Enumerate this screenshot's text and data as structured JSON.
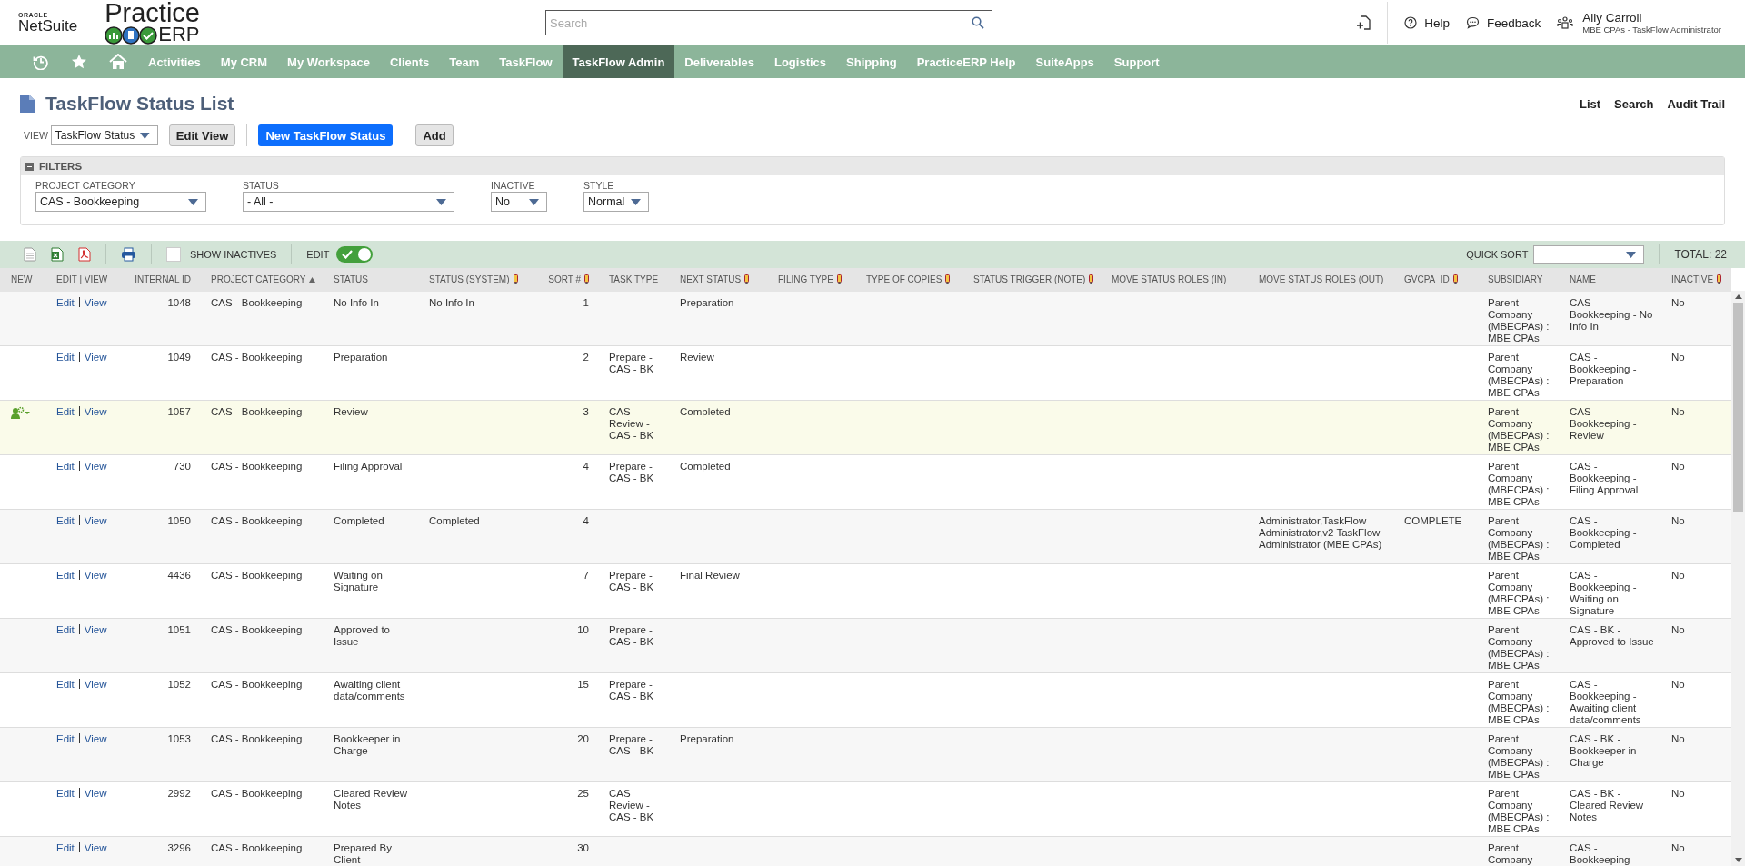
{
  "logo": {
    "oracle": "ORACLE",
    "netsuite": "NetSuite",
    "practice": "Practice",
    "erp": "ERP"
  },
  "search": {
    "placeholder": "Search"
  },
  "header_links": [
    {
      "kind": "help",
      "label": "Help"
    },
    {
      "kind": "feedback",
      "label": "Feedback"
    }
  ],
  "user": {
    "name": "Ally Carroll",
    "role": "MBE CPAs - TaskFlow Administrator"
  },
  "nav": [
    {
      "kind": "recent",
      "selected": false
    },
    {
      "kind": "star",
      "selected": false
    },
    {
      "kind": "home",
      "selected": false
    },
    {
      "kind": "text",
      "label": "Activities",
      "selected": false
    },
    {
      "kind": "text",
      "label": "My CRM",
      "selected": false
    },
    {
      "kind": "text",
      "label": "My Workspace",
      "selected": false
    },
    {
      "kind": "text",
      "label": "Clients",
      "selected": false
    },
    {
      "kind": "text",
      "label": "Team",
      "selected": false
    },
    {
      "kind": "text",
      "label": "TaskFlow",
      "selected": false
    },
    {
      "kind": "text",
      "label": "TaskFlow Admin",
      "selected": true
    },
    {
      "kind": "text",
      "label": "Deliverables",
      "selected": false
    },
    {
      "kind": "text",
      "label": "Logistics",
      "selected": false
    },
    {
      "kind": "text",
      "label": "Shipping",
      "selected": false
    },
    {
      "kind": "text",
      "label": "PracticeERP Help",
      "selected": false
    },
    {
      "kind": "text",
      "label": "SuiteApps",
      "selected": false
    },
    {
      "kind": "text",
      "label": "Support",
      "selected": false
    }
  ],
  "page_title": "TaskFlow Status List",
  "page_links": [
    "List",
    "Search",
    "Audit Trail"
  ],
  "view": {
    "label": "VIEW",
    "value": "TaskFlow Status",
    "edit_view": "Edit View",
    "new_button": "New TaskFlow Status",
    "add": "Add"
  },
  "filters": {
    "title": "FILTERS",
    "expanded": true,
    "fields": [
      {
        "label": "PROJECT CATEGORY",
        "value": "CAS - Bookkeeping"
      },
      {
        "label": "STATUS",
        "value": "- All -"
      },
      {
        "label": "INACTIVE",
        "value": "No"
      },
      {
        "label": "STYLE",
        "value": "Normal"
      }
    ]
  },
  "toolbar": {
    "show_inactives": {
      "label": "SHOW INACTIVES",
      "checked": false
    },
    "edit": {
      "label": "EDIT",
      "on": true
    },
    "quick_sort": {
      "label": "QUICK SORT"
    },
    "total": "TOTAL: 22"
  },
  "columns": [
    {
      "label": "NEW",
      "marker": false,
      "sorted": false
    },
    {
      "label": "EDIT | VIEW",
      "marker": false,
      "sorted": false
    },
    {
      "label": "INTERNAL ID",
      "marker": false,
      "sorted": false
    },
    {
      "label": "PROJECT CATEGORY",
      "marker": false,
      "sorted": true
    },
    {
      "label": "STATUS",
      "marker": false,
      "sorted": false
    },
    {
      "label": "STATUS (SYSTEM)",
      "marker": true,
      "sorted": false
    },
    {
      "label": "SORT #",
      "marker": true,
      "sorted": false
    },
    {
      "label": "TASK TYPE",
      "marker": false,
      "sorted": false
    },
    {
      "label": "NEXT STATUS",
      "marker": true,
      "sorted": false
    },
    {
      "label": "FILING TYPE",
      "marker": true,
      "sorted": false
    },
    {
      "label": "TYPE OF COPIES",
      "marker": true,
      "sorted": false
    },
    {
      "label": "STATUS TRIGGER (NOTE)",
      "marker": true,
      "sorted": false
    },
    {
      "label": "MOVE STATUS ROLES (IN)",
      "marker": false,
      "sorted": false
    },
    {
      "label": "MOVE STATUS ROLES (OUT)",
      "marker": false,
      "sorted": false
    },
    {
      "label": "GVCPA_ID",
      "marker": true,
      "sorted": false
    },
    {
      "label": "SUBSIDIARY",
      "marker": false,
      "sorted": false
    },
    {
      "label": "NAME",
      "marker": false,
      "sorted": false
    },
    {
      "label": "INACTIVE",
      "marker": true,
      "sorted": false
    }
  ],
  "rows": [
    {
      "highlighted": false,
      "edit": "Edit",
      "view": "View",
      "internal_id": "1048",
      "project_category": "CAS - Bookkeeping",
      "status": "No Info In",
      "status_system": "No Info In",
      "sort": "1",
      "next_status": "Preparation",
      "subsidiary": "Parent Company (MBECPAs) : MBE CPAs",
      "name": "CAS - Bookkeeping - No Info In",
      "inactive": "No"
    },
    {
      "highlighted": false,
      "edit": "Edit",
      "view": "View",
      "internal_id": "1049",
      "project_category": "CAS - Bookkeeping",
      "status": "Preparation",
      "sort": "2",
      "task_type": "Prepare - CAS - BK",
      "next_status": "Review",
      "subsidiary": "Parent Company (MBECPAs) : MBE CPAs",
      "name": "CAS - Bookkeeping - Preparation",
      "inactive": "No"
    },
    {
      "highlighted": true,
      "edit": "Edit",
      "view": "View",
      "internal_id": "1057",
      "project_category": "CAS - Bookkeeping",
      "status": "Review",
      "sort": "3",
      "task_type": "CAS Review - CAS - BK",
      "next_status": "Completed",
      "subsidiary": "Parent Company (MBECPAs) : MBE CPAs",
      "name": "CAS - Bookkeeping - Review",
      "inactive": "No"
    },
    {
      "highlighted": false,
      "edit": "Edit",
      "view": "View",
      "internal_id": "730",
      "project_category": "CAS - Bookkeeping",
      "status": "Filing Approval",
      "sort": "4",
      "task_type": "Prepare - CAS - BK",
      "next_status": "Completed",
      "subsidiary": "Parent Company (MBECPAs) : MBE CPAs",
      "name": "CAS - Bookkeeping - Filing Approval",
      "inactive": "No"
    },
    {
      "highlighted": false,
      "edit": "Edit",
      "view": "View",
      "internal_id": "1050",
      "project_category": "CAS - Bookkeeping",
      "status": "Completed",
      "status_system": "Completed",
      "sort": "4",
      "roles_out": "Administrator,TaskFlow Administrator,v2 TaskFlow Administrator (MBE CPAs)",
      "gvcpa_id": "COMPLETE",
      "subsidiary": "Parent Company (MBECPAs) : MBE CPAs",
      "name": "CAS - Bookkeeping - Completed",
      "inactive": "No"
    },
    {
      "highlighted": false,
      "edit": "Edit",
      "view": "View",
      "internal_id": "4436",
      "project_category": "CAS - Bookkeeping",
      "status": "Waiting on Signature",
      "sort": "7",
      "task_type": "Prepare - CAS - BK",
      "next_status": "Final Review",
      "subsidiary": "Parent Company (MBECPAs) : MBE CPAs",
      "name": "CAS - Bookkeeping - Waiting on Signature",
      "inactive": "No"
    },
    {
      "highlighted": false,
      "edit": "Edit",
      "view": "View",
      "internal_id": "1051",
      "project_category": "CAS - Bookkeeping",
      "status": "Approved to Issue",
      "sort": "10",
      "task_type": "Prepare - CAS - BK",
      "subsidiary": "Parent Company (MBECPAs) : MBE CPAs",
      "name": "CAS - BK - Approved to Issue",
      "inactive": "No"
    },
    {
      "highlighted": false,
      "edit": "Edit",
      "view": "View",
      "internal_id": "1052",
      "project_category": "CAS - Bookkeeping",
      "status": "Awaiting client data/comments",
      "sort": "15",
      "task_type": "Prepare - CAS - BK",
      "subsidiary": "Parent Company (MBECPAs) : MBE CPAs",
      "name": "CAS - Bookkeeping - Awaiting client data/comments",
      "inactive": "No"
    },
    {
      "highlighted": false,
      "edit": "Edit",
      "view": "View",
      "internal_id": "1053",
      "project_category": "CAS - Bookkeeping",
      "status": "Bookkeeper in Charge",
      "sort": "20",
      "task_type": "Prepare - CAS - BK",
      "next_status": "Preparation",
      "subsidiary": "Parent Company (MBECPAs) : MBE CPAs",
      "name": "CAS - BK - Bookkeeper in Charge",
      "inactive": "No"
    },
    {
      "highlighted": false,
      "edit": "Edit",
      "view": "View",
      "internal_id": "2992",
      "project_category": "CAS - Bookkeeping",
      "status": "Cleared Review Notes",
      "sort": "25",
      "task_type": "CAS Review - CAS - BK",
      "subsidiary": "Parent Company (MBECPAs) : MBE CPAs",
      "name": "CAS - BK - Cleared Review Notes",
      "inactive": "No"
    },
    {
      "highlighted": false,
      "edit": "Edit",
      "view": "View",
      "internal_id": "3296",
      "project_category": "CAS - Bookkeeping",
      "status": "Prepared By Client",
      "sort": "30",
      "subsidiary": "Parent Company",
      "name": "CAS - Bookkeeping -",
      "inactive": "No"
    }
  ]
}
